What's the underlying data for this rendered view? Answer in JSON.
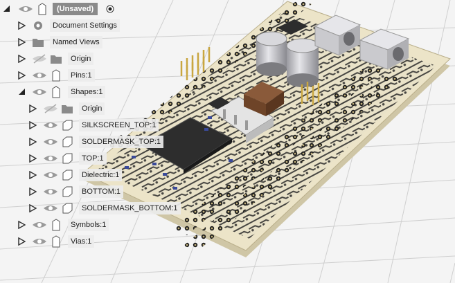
{
  "browser": {
    "root": {
      "label": "(Unsaved)"
    },
    "items": [
      {
        "label": "Document Settings"
      },
      {
        "label": "Named Views"
      },
      {
        "label": "Origin"
      },
      {
        "label": "Pins:1"
      },
      {
        "label": "Shapes:1"
      },
      {
        "label": "Origin"
      },
      {
        "label": "SILKSCREEN_TOP:1"
      },
      {
        "label": "SOLDERMASK_TOP:1"
      },
      {
        "label": "TOP:1"
      },
      {
        "label": "Dielectric:1"
      },
      {
        "label": "BOTTOM:1"
      },
      {
        "label": "SOLDERMASK_BOTTOM:1"
      },
      {
        "label": "Symbols:1"
      },
      {
        "label": "Vias:1"
      }
    ]
  },
  "colors": {
    "board": "#ece4c8",
    "trace": "#2a2a2a",
    "pin_gold": "#c9a640",
    "ic": "#2d2d2d",
    "cap": "#c8c8cc",
    "root_label_bg": "#8a8a8a"
  }
}
